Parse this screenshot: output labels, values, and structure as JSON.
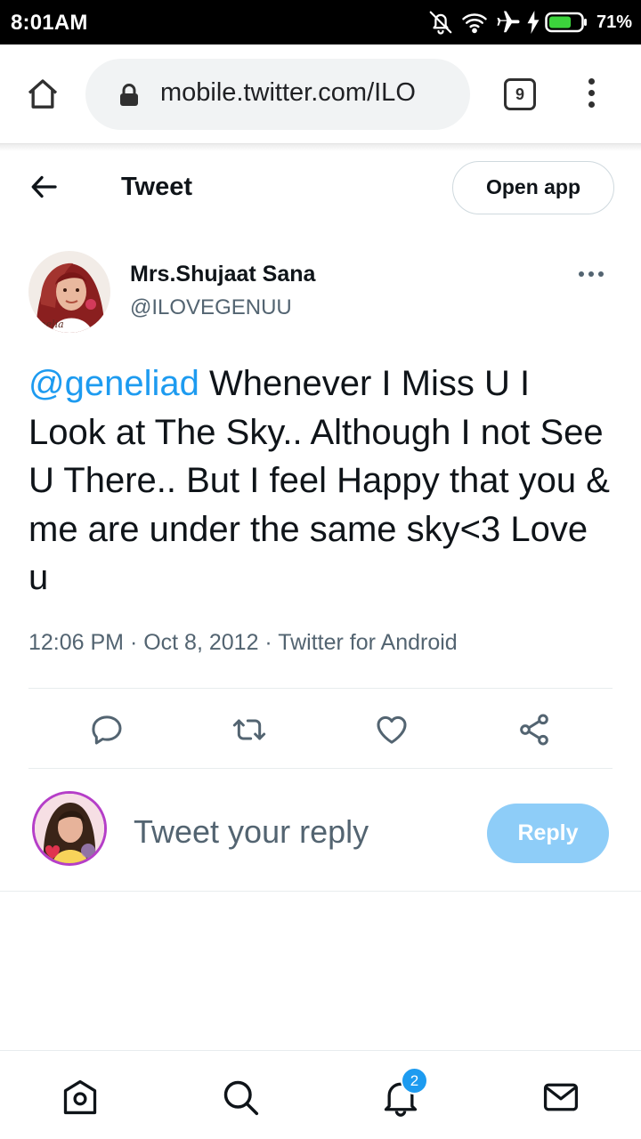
{
  "status_bar": {
    "time": "8:01AM",
    "battery_percent": "71%",
    "battery_level": 0.71,
    "icons": [
      "notifications-off-icon",
      "wifi-icon",
      "airplane-icon",
      "charging-icon",
      "battery-icon"
    ]
  },
  "browser": {
    "url": "mobile.twitter.com/ILO",
    "tab_count": "9",
    "icons": [
      "home-icon",
      "lock-icon",
      "menu-icon"
    ]
  },
  "header": {
    "title": "Tweet",
    "open_app_label": "Open app"
  },
  "tweet": {
    "author_name": "Mrs.Shujaat Sana",
    "author_handle": "@ILOVEGENUU",
    "avatar_caption": "enelia",
    "mention": "@geneliad",
    "text": " Whenever I Miss U I Look at The Sky.. Although I not See U There.. But I feel Happy that you & me are under the same sky<3 Love u",
    "timestamp": "12:06 PM · Oct 8, 2012 · Twitter for Android"
  },
  "actions": [
    "reply-icon",
    "retweet-icon",
    "like-icon",
    "share-icon"
  ],
  "reply": {
    "placeholder": "Tweet your reply",
    "button_label": "Reply"
  },
  "bottom_nav": {
    "items": [
      "home-icon",
      "search-icon",
      "notifications-icon",
      "messages-icon"
    ],
    "notification_badge": "2"
  },
  "colors": {
    "accent": "#1d9bf0",
    "reply_button": "#8ecdf8",
    "secondary_text": "#536471"
  }
}
